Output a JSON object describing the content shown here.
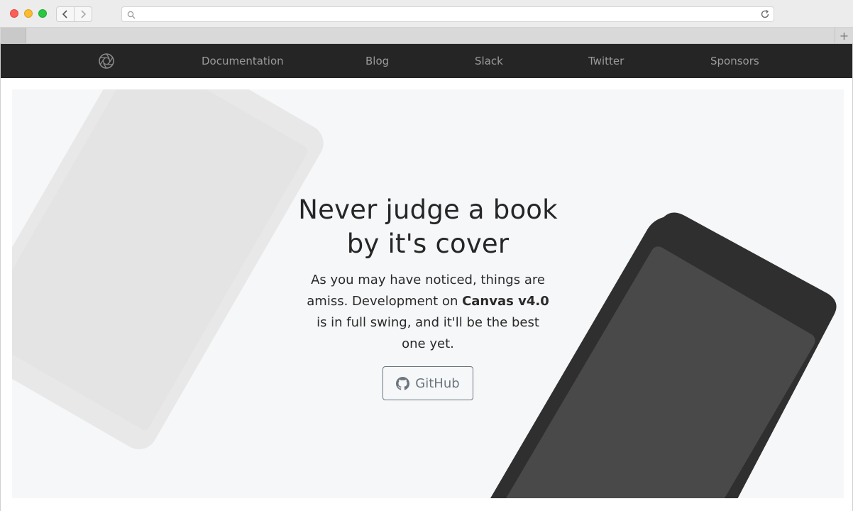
{
  "browser": {
    "address_value": "",
    "new_tab_label": "+"
  },
  "nav": {
    "links": [
      "Documentation",
      "Blog",
      "Slack",
      "Twitter",
      "Sponsors"
    ]
  },
  "hero": {
    "title_line1": "Never judge a book",
    "title_line2": "by it's cover",
    "text_before": "As you may have noticed, things are amiss. Development on ",
    "text_bold": "Canvas v4.0",
    "text_after": " is in full swing, and it'll be the best one yet.",
    "button_label": "GitHub"
  },
  "colors": {
    "nav_background": "#252525",
    "nav_link": "#9b9b9b",
    "hero_background": "#f6f7f9",
    "dark_phone": "#2f2f2f",
    "light_tablet": "#e9e9e9",
    "button_outline": "#6c757d"
  },
  "icons": {
    "logo": "aperture-icon",
    "button": "github-icon",
    "back": "chevron-left-icon",
    "forward": "chevron-right-icon",
    "search": "search-icon",
    "reload": "reload-icon"
  }
}
